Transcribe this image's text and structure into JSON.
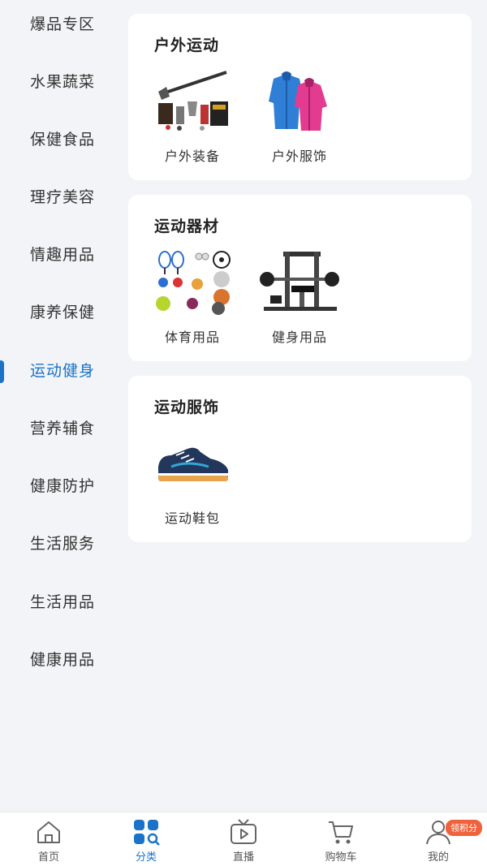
{
  "sidebar": {
    "items": [
      {
        "label": "爆品专区"
      },
      {
        "label": "水果蔬菜"
      },
      {
        "label": "保健食品"
      },
      {
        "label": "理疗美容"
      },
      {
        "label": "情趣用品"
      },
      {
        "label": "康养保健"
      },
      {
        "label": "运动健身"
      },
      {
        "label": "营养辅食"
      },
      {
        "label": "健康防护"
      },
      {
        "label": "生活服务"
      },
      {
        "label": "生活用品"
      },
      {
        "label": "健康用品"
      }
    ],
    "active_label": "运动健身"
  },
  "sections": [
    {
      "title": "户外运动",
      "products": [
        {
          "label": "户外装备",
          "icon": "outdoor-gear-image"
        },
        {
          "label": "户外服饰",
          "icon": "outdoor-jacket-image"
        }
      ]
    },
    {
      "title": "运动器材",
      "products": [
        {
          "label": "体育用品",
          "icon": "sports-balls-image"
        },
        {
          "label": "健身用品",
          "icon": "gym-machine-image"
        }
      ]
    },
    {
      "title": "运动服饰",
      "products": [
        {
          "label": "运动鞋包",
          "icon": "sneaker-image"
        }
      ]
    }
  ],
  "tabbar": {
    "tabs": [
      {
        "label": "首页",
        "icon": "home-icon"
      },
      {
        "label": "分类",
        "icon": "category-icon"
      },
      {
        "label": "直播",
        "icon": "live-tv-icon"
      },
      {
        "label": "购物车",
        "icon": "cart-icon"
      },
      {
        "label": "我的",
        "icon": "user-icon"
      }
    ],
    "active_label": "分类",
    "profile_badge": "领积分"
  },
  "colors": {
    "accent": "#1a73c8",
    "background": "#f3f4f7",
    "card": "#ffffff",
    "badge": "#f0623c"
  }
}
